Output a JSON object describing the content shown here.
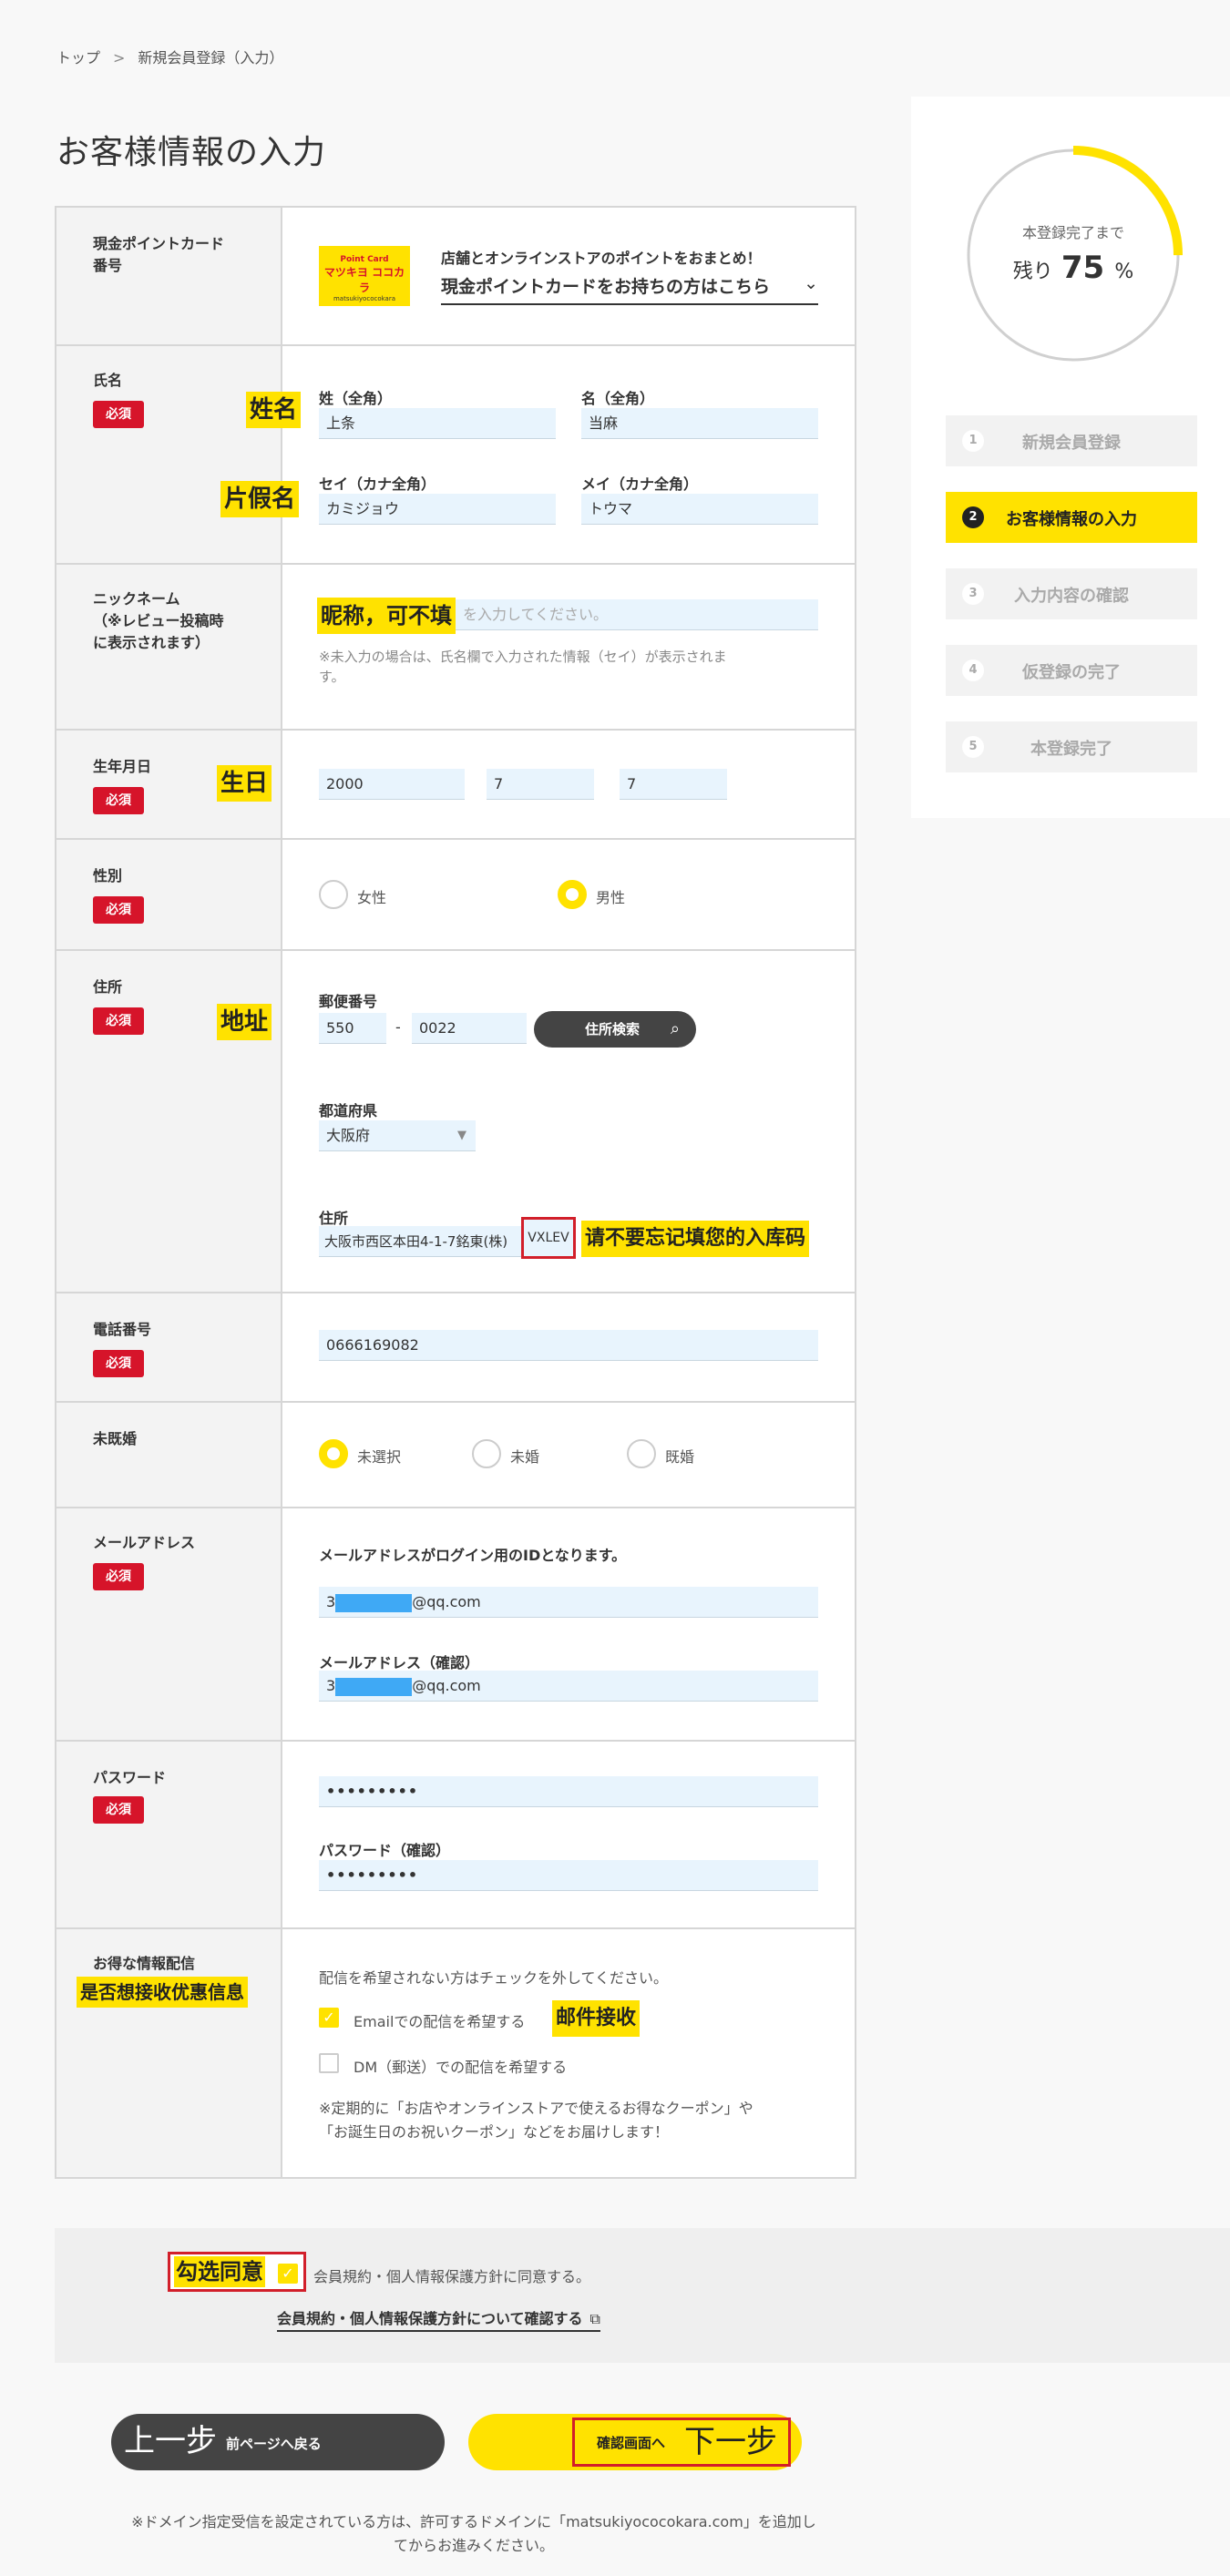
{
  "breadcrumb": {
    "home": "トップ",
    "sep": ">",
    "current": "新規会員登録（入力）"
  },
  "page_title": "お客様情報の入力",
  "progress": {
    "caption": "本登録完了まで",
    "remain_prefix": "残り",
    "percent": "75",
    "unit": "%",
    "fraction": 0.25,
    "accent": "#ffe200"
  },
  "steps": [
    {
      "num": "1",
      "label": "新規会員登録",
      "active": false
    },
    {
      "num": "2",
      "label": "お客様情報の入力",
      "active": true
    },
    {
      "num": "3",
      "label": "入力内容の確認",
      "active": false
    },
    {
      "num": "4",
      "label": "仮登録の完了",
      "active": false
    },
    {
      "num": "5",
      "label": "本登録完了",
      "active": false
    }
  ],
  "point_card": {
    "label_line1": "現金ポイントカード",
    "label_line2": "番号",
    "logo_top": "Point Card",
    "logo_main": "マツキヨ ココカラ",
    "logo_sub": "matsukiyococokara",
    "promo": "店舗とオンラインストアのポイントをおまとめ！",
    "link": "現金ポイントカードをお持ちの方はこちら"
  },
  "name": {
    "label": "氏名",
    "required": "必須",
    "annot_name": "姓名",
    "annot_kana": "片假名",
    "sei_label": "姓（全角）",
    "sei": "上条",
    "mei_label": "名（全角）",
    "mei": "当麻",
    "sei_kana_label": "セイ（カナ全角）",
    "sei_kana": "カミジョウ",
    "mei_kana_label": "メイ（カナ全角）",
    "mei_kana": "トウマ"
  },
  "nickname": {
    "label_line1": "ニックネーム",
    "label_line2": "（※レビュー投稿時",
    "label_line3": "に表示されます）",
    "annot": "昵称，可不填",
    "placeholder_tail": "を入力してください。",
    "note_line1": "※未入力の場合は、氏名欄で入力された情報（セイ）が表示されま",
    "note_line2": "す。"
  },
  "birthday": {
    "label": "生年月日",
    "required": "必須",
    "annot": "生日",
    "year": "2000",
    "month": "7",
    "day": "7"
  },
  "gender": {
    "label": "性別",
    "required": "必須",
    "female": "女性",
    "male": "男性",
    "selected": "男性"
  },
  "address": {
    "label": "住所",
    "required": "必須",
    "annot": "地址",
    "zip_label": "郵便番号",
    "zip1": "550",
    "zip_dash": "-",
    "zip2": "0022",
    "search_button": "住所検索",
    "pref_label": "都道府県",
    "pref": "大阪府",
    "addr_label": "住所",
    "addr": "大阪市西区本田4-1-7銘東(株)",
    "code": "VXLEV",
    "code_annot": "请不要忘记填您的入库码"
  },
  "phone": {
    "label": "電話番号",
    "required": "必須",
    "value": "0666169082"
  },
  "marital": {
    "label": "未既婚",
    "options": [
      "未選択",
      "未婚",
      "既婚"
    ],
    "selected": "未選択"
  },
  "email": {
    "label": "メールアドレス",
    "required": "必須",
    "note": "メールアドレスがログイン用のIDとなります。",
    "value_prefix": "3",
    "value_suffix": "@qq.com",
    "confirm_label": "メールアドレス（確認）",
    "confirm_prefix": "3",
    "confirm_suffix": "@qq.com"
  },
  "password": {
    "label": "パスワード",
    "required": "必須",
    "value": "•••••••••",
    "confirm_label": "パスワード（確認）",
    "confirm_value": "•••••••••"
  },
  "newsletter": {
    "label": "お得な情報配信",
    "annot": "是否想接收优惠信息",
    "note": "配信を希望されない方はチェックを外してください。",
    "email_opt": "Emailでの配信を希望する",
    "email_checked": true,
    "email_annot": "邮件接收",
    "dm_opt": "DM（郵送）での配信を希望する",
    "dm_checked": false,
    "coupon_line1": "※定期的に「お店やオンラインストアで使えるお得なクーポン」や",
    "coupon_line2": "「お誕生日のお祝いクーポン」などをお届けします！"
  },
  "agree": {
    "annot": "勾选同意",
    "text": "会員規約・個人情報保護方針に同意する。",
    "link": "会員規約・個人情報保護方針について確認する"
  },
  "buttons": {
    "back_annot": "上一步",
    "back_label": "前ページへ戻る",
    "next_label": "確認画面へ",
    "next_annot": "下一步"
  },
  "footer": {
    "line1": "※ドメイン指定受信を設定されている方は、許可するドメインに「matsukiyococokara.com」を追加し",
    "line2": "てからお進みください。"
  }
}
